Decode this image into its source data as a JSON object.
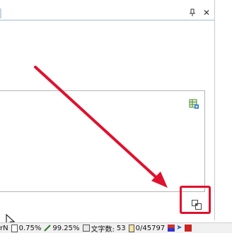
{
  "pane": {
    "pin_glyph": "↑",
    "close_glyph": "✕"
  },
  "status_bar": {
    "cut_text": "rN",
    "zoom_a": "0.75%",
    "zoom_b": "99.25%",
    "word_label": "文字数:",
    "word_count": "53",
    "page_count": "0/45797"
  },
  "colors": {
    "annotation_red": "#e0112e",
    "border_blue": "#9dbcd4"
  },
  "icons": {
    "sheet": "table-sheet-icon",
    "resize": "resize-icon",
    "pin": "pin-icon",
    "close": "close-icon"
  }
}
